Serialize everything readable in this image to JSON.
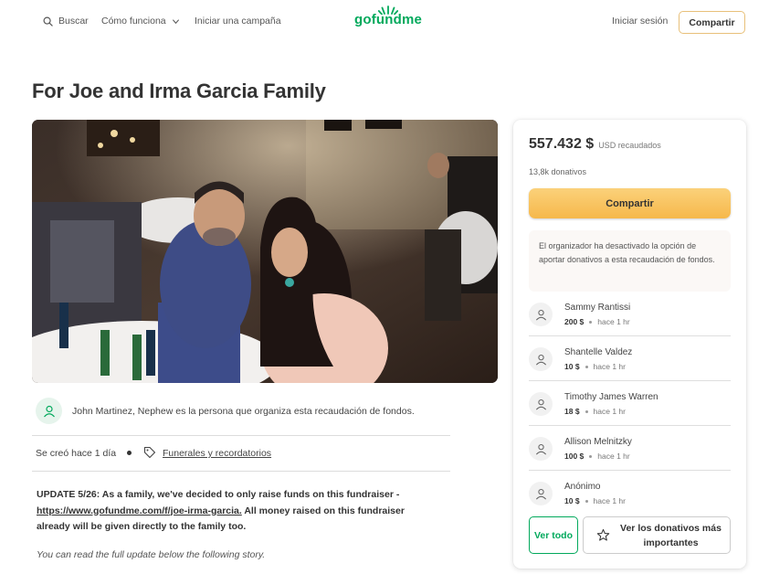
{
  "header": {
    "search_label": "Buscar",
    "how_it_works_label": "Cómo funciona",
    "start_campaign_label": "Iniciar una campaña",
    "logo_text": "gofundme",
    "signin_label": "Iniciar sesión",
    "share_label": "Compartir"
  },
  "campaign": {
    "title": "For Joe and Irma Garcia Family",
    "organizer_text": "John Martinez, Nephew es la persona que organiza esta recaudación de fondos.",
    "created_text": "Se creó hace 1 día",
    "category": "Funerales y recordatorios",
    "update_prefix": "UPDATE 5/26: As a family, we've decided to only raise funds on this fundraiser -",
    "update_link": "https://www.gofundme.com/f/joe-irma-garcia.",
    "update_suffix": " All money raised on this fundraiser already will be given directly to the family too.",
    "more_note": "You can read the full update below the  following story."
  },
  "donation_card": {
    "raised_amount": "557.432 $",
    "raised_label": "USD recaudados",
    "donation_count": "13,8k donativos",
    "share_label": "Compartir",
    "notice": "El organizador ha desactivado la opción de aportar donativos a esta recaudación de fondos.",
    "donations": [
      {
        "name": "Sammy Rantissi",
        "amount": "200 $",
        "time": "hace 1 hr"
      },
      {
        "name": "Shantelle Valdez",
        "amount": "10 $",
        "time": "hace 1 hr"
      },
      {
        "name": "Timothy James Warren",
        "amount": "18 $",
        "time": "hace 1 hr"
      },
      {
        "name": "Allison Melnitzky",
        "amount": "100 $",
        "time": "hace 1 hr"
      },
      {
        "name": "Anónimo",
        "amount": "10 $",
        "time": "hace 1 hr"
      }
    ],
    "see_all_label": "Ver todo",
    "see_top_label": "Ver los donativos más importantes"
  },
  "colors": {
    "brand_green": "#02a95c",
    "share_gold": "#f6b84b"
  },
  "icons": {
    "search": "search-icon",
    "chevron": "chevron-down-icon",
    "tag": "tag-icon",
    "donor": "donor-hand-heart-icon",
    "star": "star-icon"
  }
}
